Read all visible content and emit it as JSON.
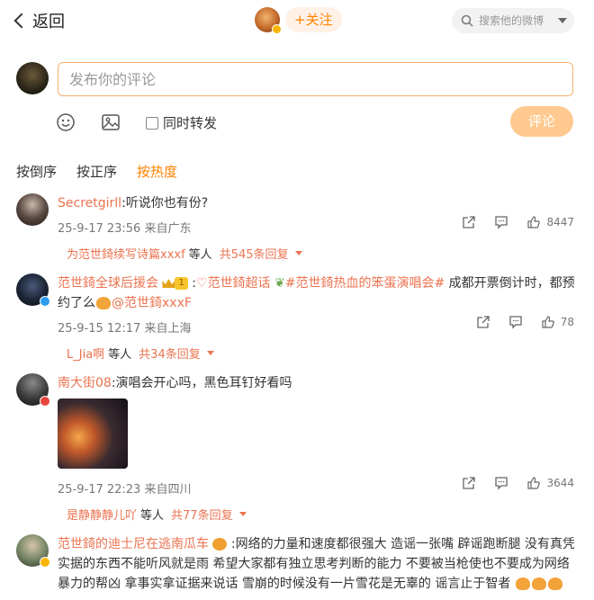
{
  "header": {
    "back_label": "返回",
    "follow_label": "+关注",
    "search_placeholder": "搜索他的微博"
  },
  "composer": {
    "placeholder": "发布你的评论",
    "repost_label": "同时转发",
    "submit_label": "评论"
  },
  "sorts": {
    "items": [
      "按倒序",
      "按正序",
      "按热度"
    ],
    "active": "按热度"
  },
  "comments": [
    {
      "user": "Secretgirll",
      "text": ":听说你也有份?",
      "time": "25-9-17 23:56",
      "location": "来自广东",
      "reply_user": "为范世錡续写诗篇xxxf",
      "reply_mid": " 等人",
      "reply_count": "共545条回复",
      "likes": "8447"
    },
    {
      "user": "范世錡全球后援会",
      "level": "1",
      "text_pre": ":",
      "topic1": "范世錡超话",
      "topic2": "#范世錡热血的笨蛋演唱会#",
      "text_post": " 成都开票倒计时，都预约了么",
      "mention": "@范世錡xxxF",
      "time": "25-9-15 12:17",
      "location": "来自上海",
      "reply_user": "L_Jia啊",
      "reply_mid": " 等人",
      "reply_count": "共34条回复",
      "likes": "78"
    },
    {
      "user": "南大街08",
      "text": ":演唱会开心吗，黑色耳钉好看吗",
      "time": "25-9-17 22:23",
      "location": "来自四川",
      "reply_user": "是静静静儿吖",
      "reply_mid": " 等人",
      "reply_count": "共77条回复",
      "likes": "3644"
    },
    {
      "user": "范世錡的迪士尼在逃南瓜车",
      "text": ":网络的力量和速度都很强大  造谣一张嘴  辟谣跑断腿 没有真凭实据的东西不能听风就是雨  希望大家都有独立思考判断的能力  不要被当枪使也不要成为网络暴力的帮凶  拿事实拿证据来说话  雪崩的时候没有一片雪花是无辜的  谣言止于智者"
    }
  ],
  "colors": {
    "accent": "#ff8200",
    "username": "#eb7350",
    "submit_disabled": "#ffc98f"
  }
}
